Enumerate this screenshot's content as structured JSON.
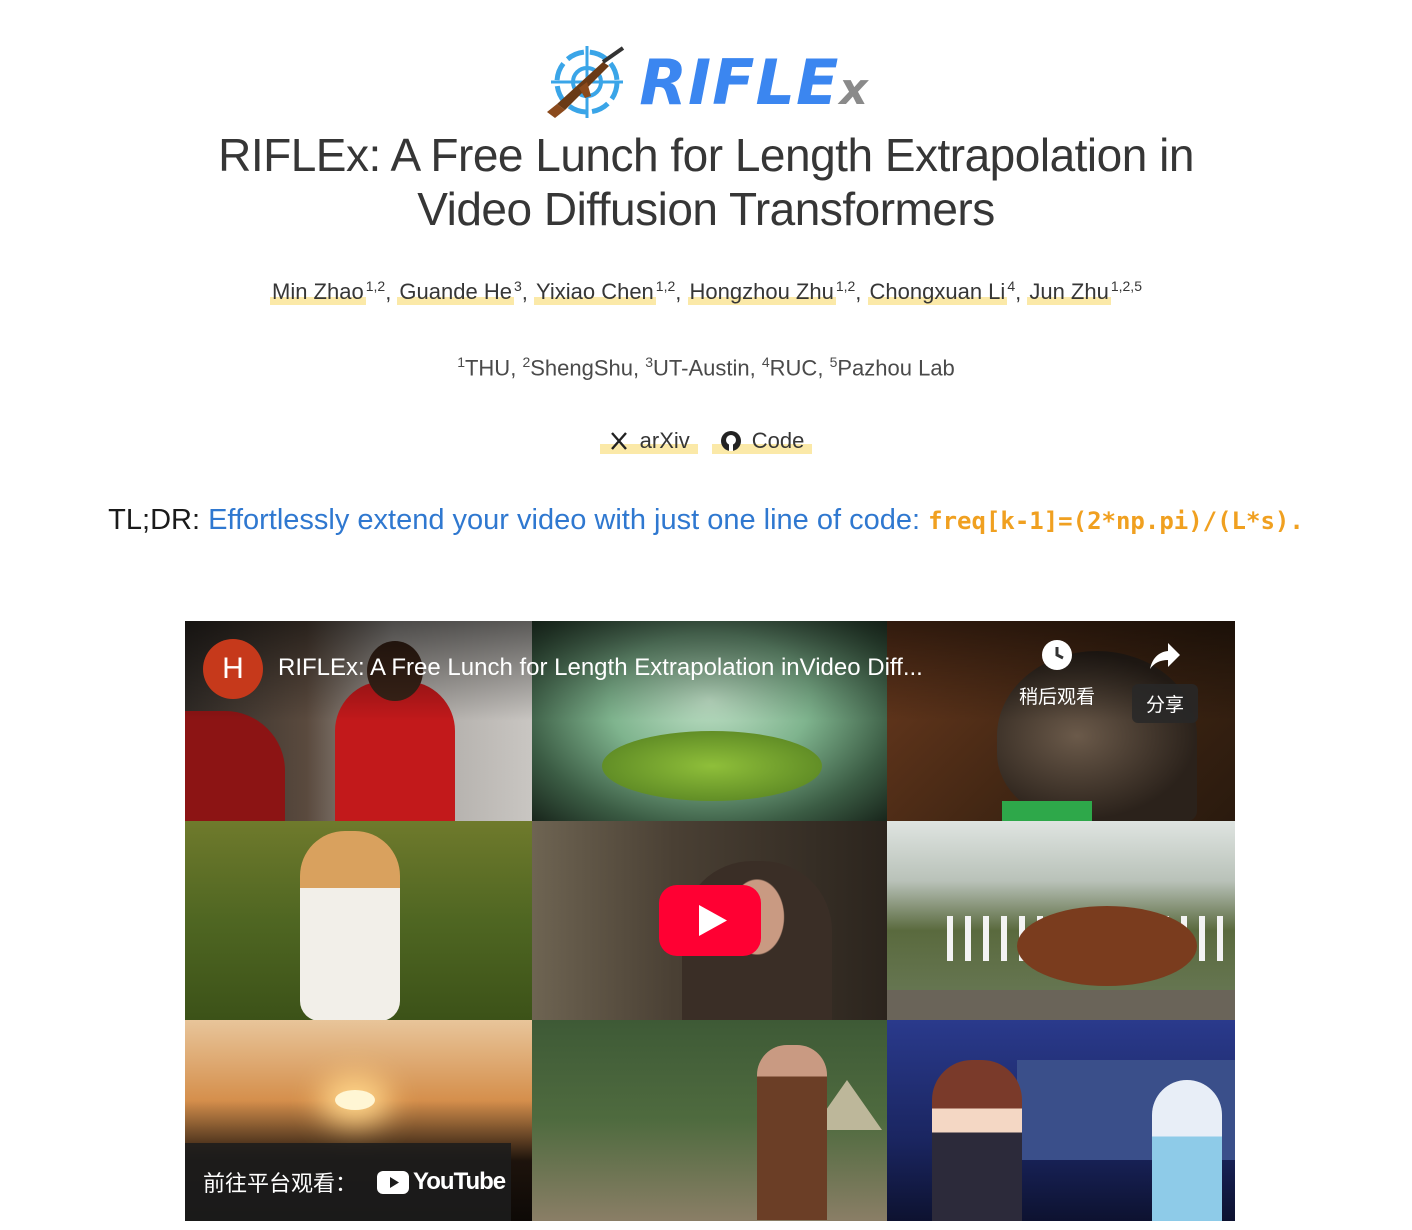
{
  "header": {
    "logo_text": "RIFLE",
    "logo_text_x": "x",
    "title_line1": "RIFLEx: A Free Lunch for Length Extrapolation in",
    "title_line2": "Video Diffusion Transformers"
  },
  "authors": [
    {
      "name": "Min Zhao",
      "sup": "1,2"
    },
    {
      "name": "Guande He",
      "sup": "3"
    },
    {
      "name": "Yixiao Chen",
      "sup": "1,2"
    },
    {
      "name": "Hongzhou Zhu",
      "sup": "1,2"
    },
    {
      "name": "Chongxuan Li",
      "sup": "4"
    },
    {
      "name": "Jun Zhu",
      "sup": "1,2,5"
    }
  ],
  "affiliations": [
    {
      "sup": "1",
      "name": "THU"
    },
    {
      "sup": "2",
      "name": "ShengShu"
    },
    {
      "sup": "3",
      "name": "UT-Austin"
    },
    {
      "sup": "4",
      "name": "RUC"
    },
    {
      "sup": "5",
      "name": "Pazhou Lab"
    }
  ],
  "links": {
    "arxiv_label": "arXiv",
    "code_label": "Code"
  },
  "tldr": {
    "lead": "TL;DR:",
    "message": "Effortlessly extend your video with just one line of code:",
    "code": "freq[k-1]=(2*np.pi)/(L*s)."
  },
  "video": {
    "channel_initial": "H",
    "title": "RIFLEx: A Free Lunch for Length Extrapolation inVideo Diff...",
    "watch_later_label": "稍后观看",
    "share_label": "分享",
    "watch_on_label": "前往平台观看：",
    "platform_label": "YouTube"
  },
  "colors": {
    "accent_blue": "#2f78d0",
    "code_orange": "#f0a020",
    "highlight_yellow": "#fbe9a8",
    "play_red": "#ff0033"
  }
}
